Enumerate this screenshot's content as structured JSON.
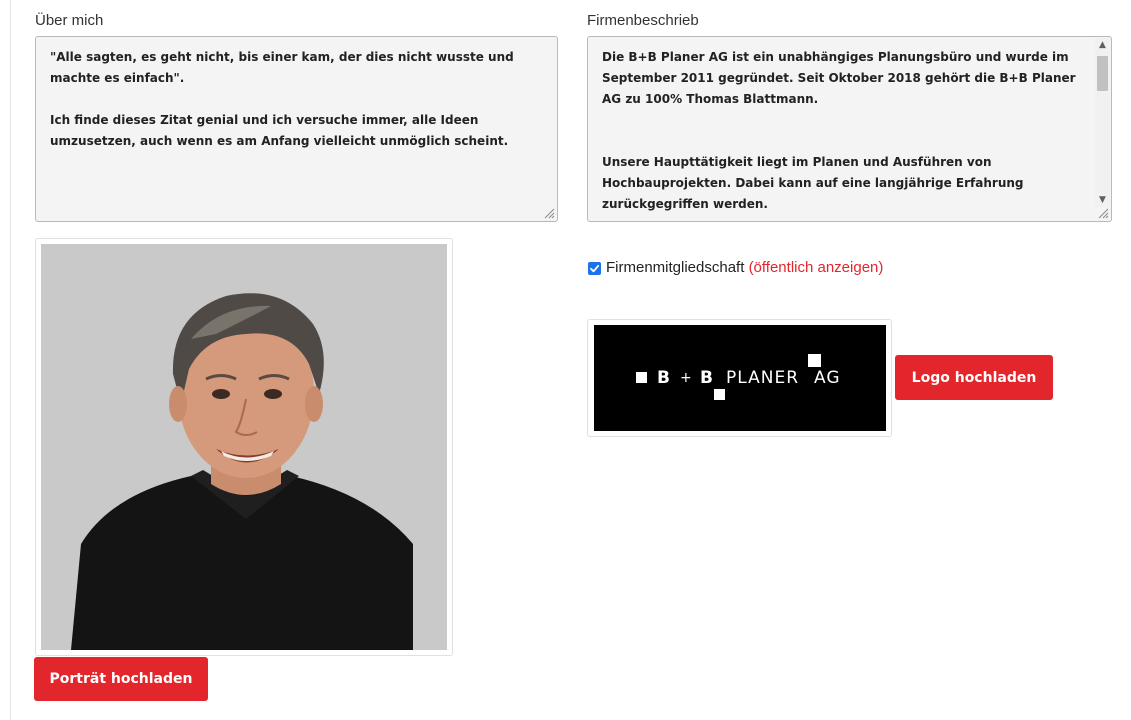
{
  "about": {
    "label": "Über mich",
    "paragraphs": [
      "\"Alle sagten, es geht nicht, bis einer kam, der dies nicht wusste und machte es einfach\".",
      "Ich finde dieses Zitat genial und ich versuche immer, alle Ideen umzusetzen, auch wenn es am Anfang vielleicht unmöglich scheint."
    ]
  },
  "company": {
    "label": "Firmenbeschrieb",
    "paragraphs": [
      "Die B+B Planer AG ist ein unabhängiges Planungsbüro und wurde im September 2011 gegründet. Seit Oktober 2018 gehört die B+B Planer AG zu 100% Thomas Blattmann.",
      "Unsere Haupttätigkeit liegt im Planen und Ausführen von Hochbauprojekten. Dabei kann auf eine langjährige Erfahrung zurückgegriffen werden."
    ]
  },
  "membership": {
    "checked": true,
    "label": "Firmenmitgliedschaft",
    "note": "(öffentlich anzeigen)"
  },
  "logo": {
    "text": "■ B + B PLANER AG",
    "upload_label": "Logo hochladen"
  },
  "portrait": {
    "upload_label": "Porträt hochladen"
  },
  "colors": {
    "accent": "#e3262c",
    "checkbox": "#1a73e8"
  }
}
